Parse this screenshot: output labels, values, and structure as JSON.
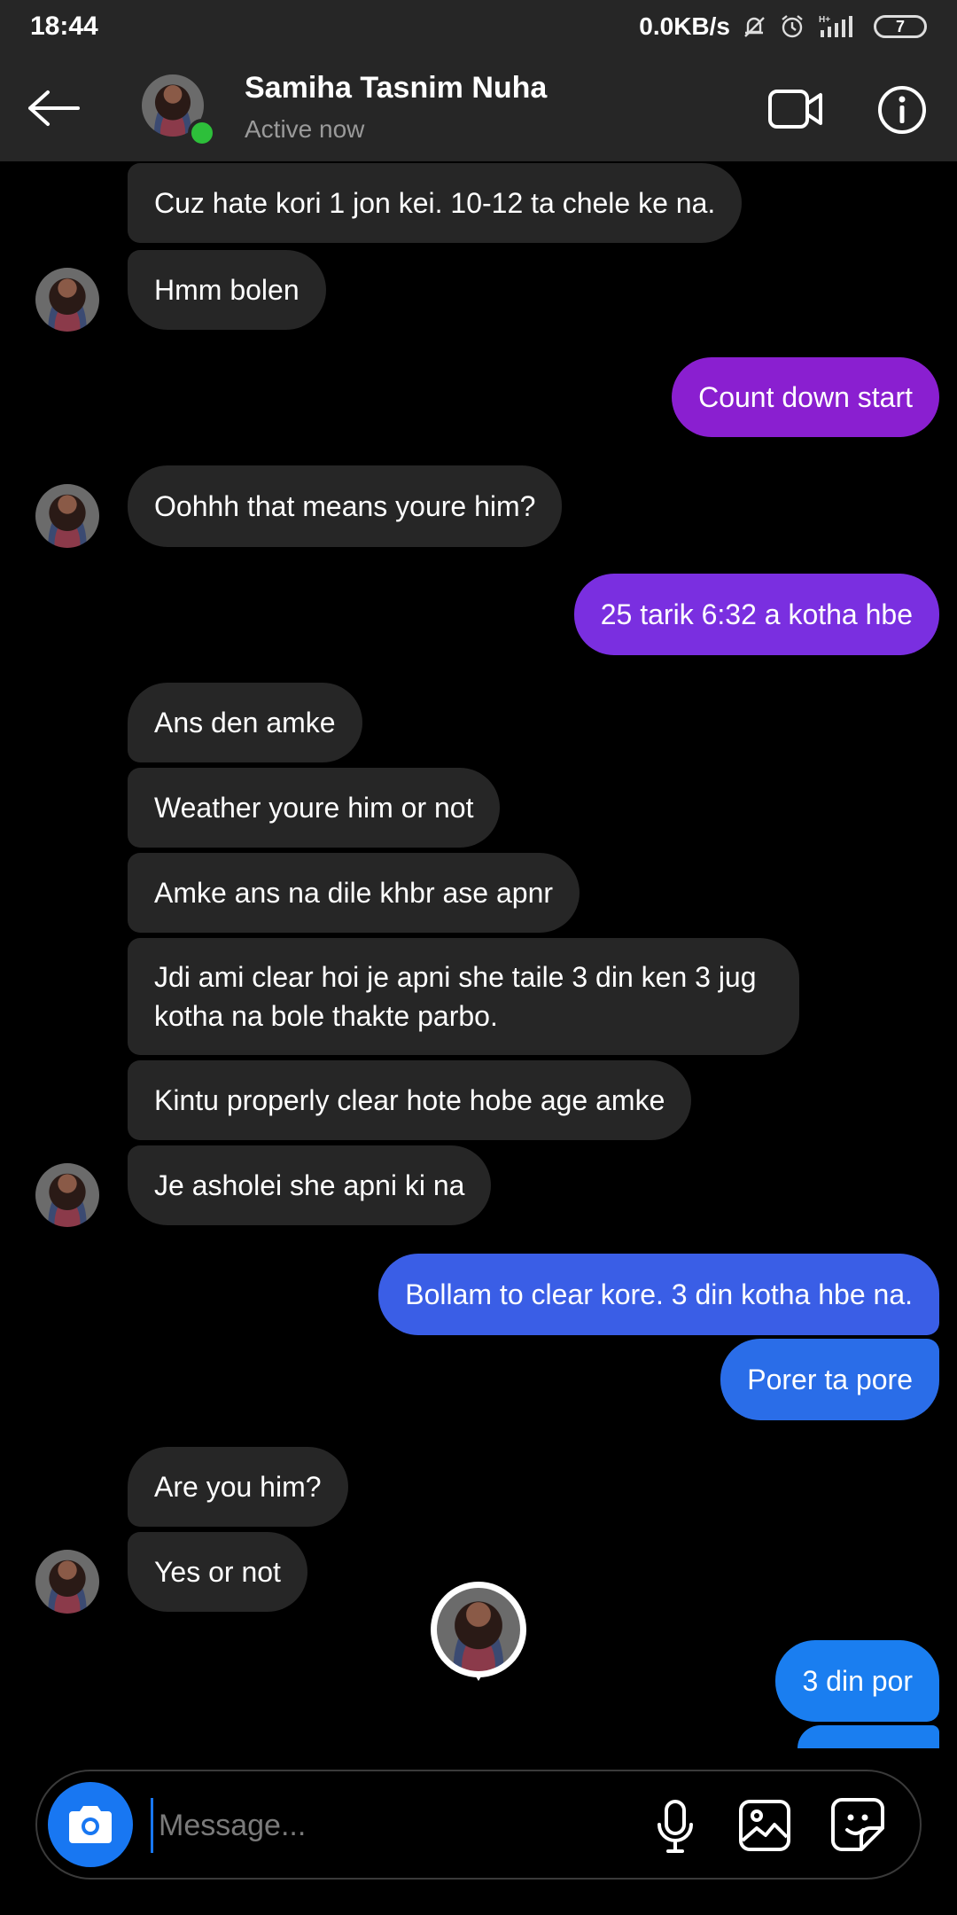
{
  "status_bar": {
    "time": "18:44",
    "network_speed": "0.0KB/s",
    "network_type": "H+",
    "battery_level": "7",
    "icons": [
      "mute-icon",
      "alarm-icon",
      "signal-icon",
      "battery-icon"
    ]
  },
  "header": {
    "contact_name": "Samiha Tasnim Nuha",
    "status": "Active now",
    "icons": [
      "back-arrow-icon",
      "video-call-icon",
      "info-icon"
    ]
  },
  "messages": [
    {
      "side": "in",
      "text": "Cuz hate kori 1 jon kei. 10-12 ta chele ke na."
    },
    {
      "side": "in",
      "text": "Hmm bolen",
      "avatar": true
    },
    {
      "side": "out",
      "text": "Count down start",
      "color": "#8a1fd0"
    },
    {
      "side": "in",
      "text": "Oohhh that means youre him?",
      "avatar": true
    },
    {
      "side": "out",
      "text": "25 tarik 6:32 a kotha hbe",
      "color": "#7a2fe0"
    },
    {
      "side": "in",
      "text": "Ans den amke"
    },
    {
      "side": "in",
      "text": "Weather youre him or not"
    },
    {
      "side": "in",
      "text": "Amke ans na dile khbr ase apnr"
    },
    {
      "side": "in",
      "text": "Jdi ami clear hoi je apni she taile 3 din ken 3 jug kotha na bole thakte parbo."
    },
    {
      "side": "in",
      "text": "Kintu properly clear hote hobe age amke"
    },
    {
      "side": "in",
      "text": "Je asholei she apni ki na",
      "avatar": true
    },
    {
      "side": "out",
      "text": "Bollam to clear kore. 3 din kotha hbe na.",
      "color": "#3a5ee6"
    },
    {
      "side": "out",
      "text": "Porer ta pore",
      "color": "#2a6de8"
    },
    {
      "side": "in",
      "text": "Are you him?"
    },
    {
      "side": "in",
      "text": "Yes or not",
      "avatar": true
    },
    {
      "side": "out",
      "text": "3 din por",
      "color": "#1a7ef0"
    }
  ],
  "composer": {
    "placeholder": "Message...",
    "icons": [
      "camera-icon",
      "microphone-icon",
      "gallery-icon",
      "sticker-icon"
    ]
  },
  "colors": {
    "background": "#000000",
    "incoming_bubble": "#262626",
    "accent": "#1877f2",
    "online": "#2dbf3a"
  }
}
